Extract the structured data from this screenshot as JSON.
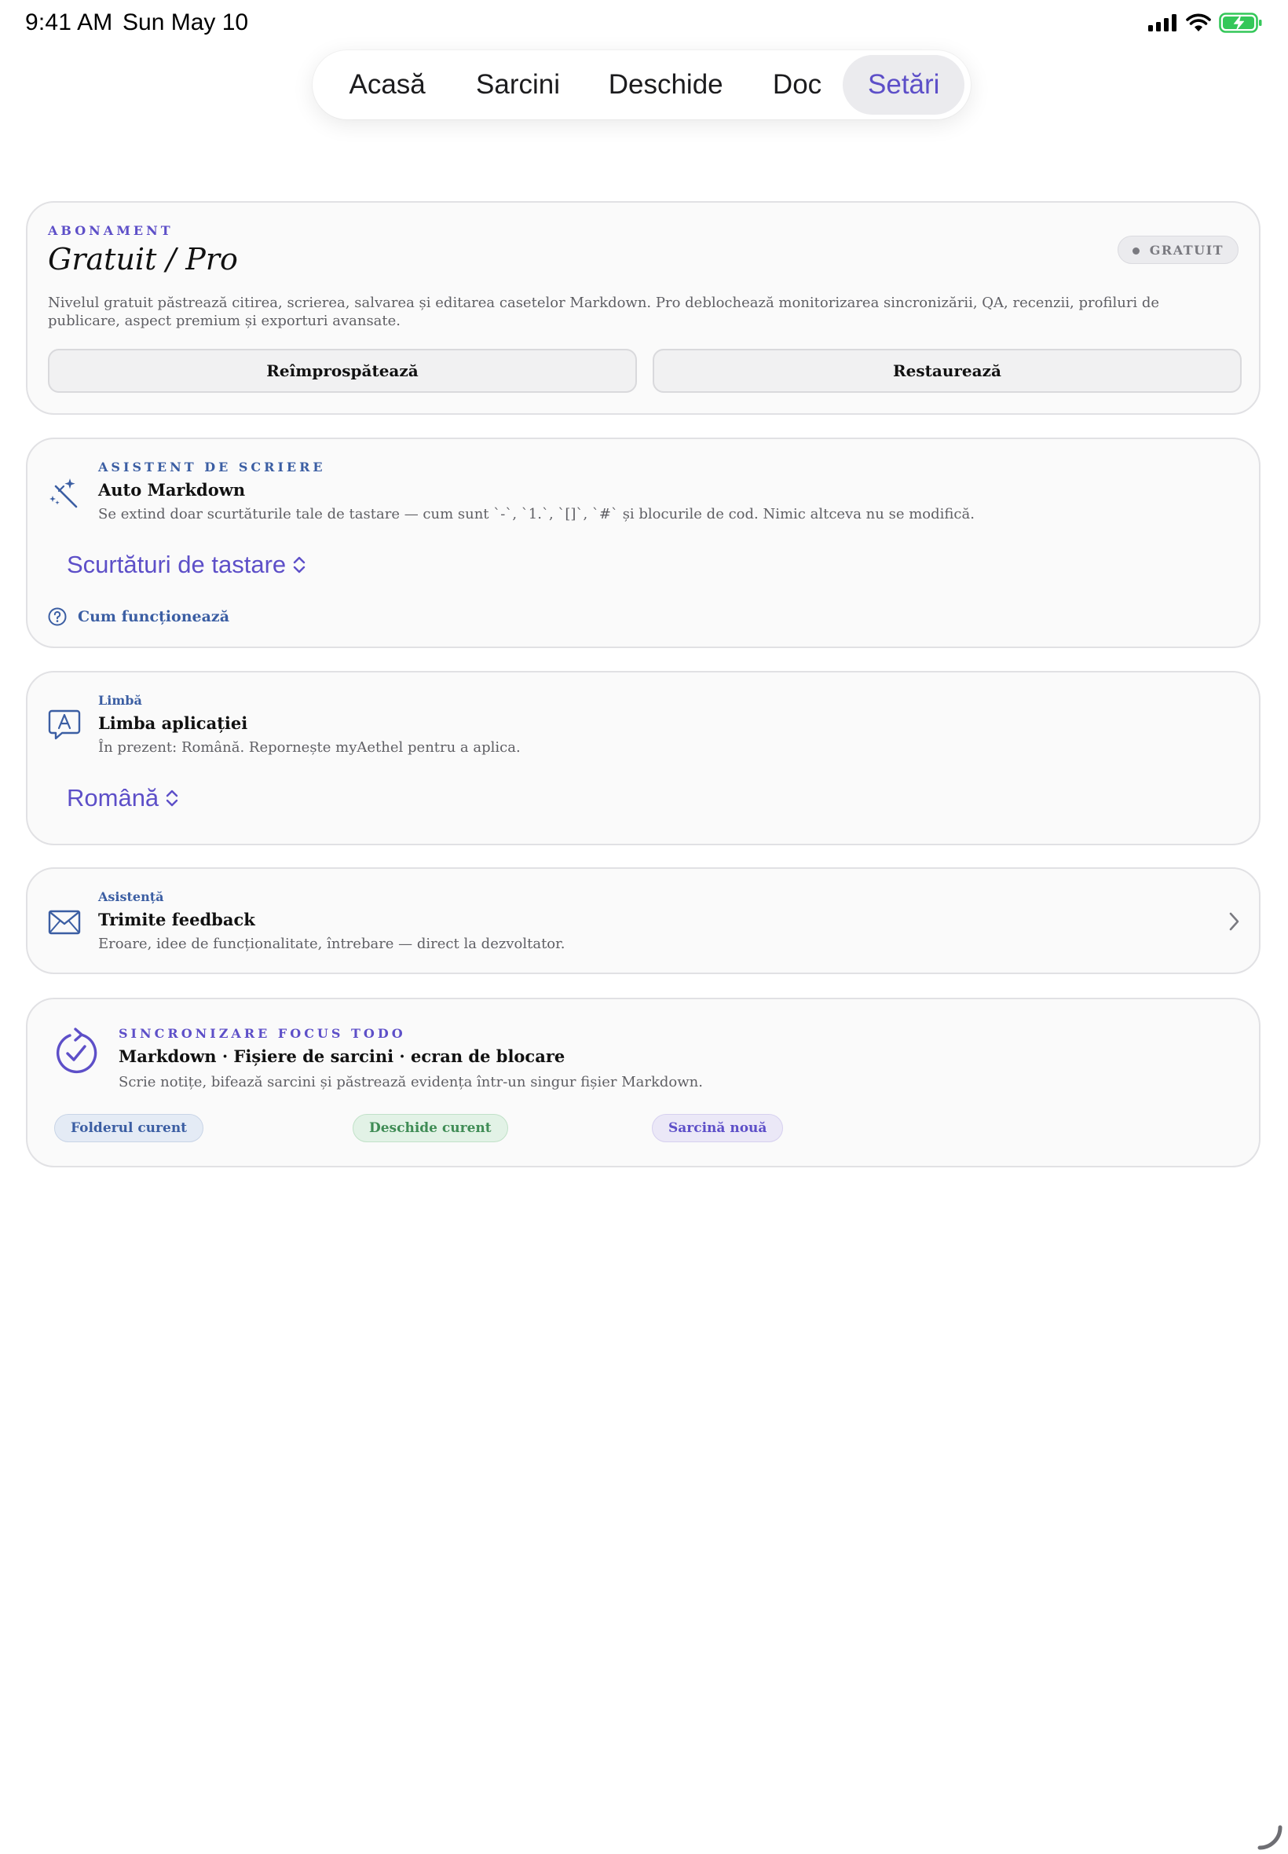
{
  "status_bar": {
    "time": "9:41 AM",
    "date": "Sun May 10"
  },
  "tabs": [
    {
      "label": "Acasă",
      "active": false
    },
    {
      "label": "Sarcini",
      "active": false
    },
    {
      "label": "Deschide",
      "active": false
    },
    {
      "label": "Doc",
      "active": false
    },
    {
      "label": "Setări",
      "active": true
    }
  ],
  "subscription": {
    "eyebrow": "ABONAMENT",
    "title": "Gratuit / Pro",
    "badge": "GRATUIT",
    "description": "Nivelul gratuit păstrează citirea, scrierea, salvarea și editarea casetelor Markdown. Pro deblochează monitorizarea sincronizării, QA, recenzii, profiluri de publicare, aspect premium și exporturi avansate.",
    "refresh_label": "Reîmprospătează",
    "restore_label": "Restaurează"
  },
  "writing_assistant": {
    "icon": "magic-wand-icon",
    "eyebrow": "ASISTENT DE SCRIERE",
    "title": "Auto Markdown",
    "description": "Se extind doar scurtăturile tale de tastare — cum sunt `-`, `1.`, `[]`, `#` și blocurile de cod. Nimic altceva nu se modifică.",
    "picker_value": "Scurtături de tastare",
    "help_label": "Cum funcționează"
  },
  "language": {
    "icon": "language-bubble-icon",
    "eyebrow": "Limbă",
    "title": "Limba aplicației",
    "description": "În prezent: Română. Repornește myAethel pentru a aplica.",
    "picker_value": "Română"
  },
  "support": {
    "icon": "envelope-icon",
    "eyebrow": "Asistență",
    "title": "Trimite feedback",
    "description": "Eroare, idee de funcționalitate, întrebare — direct la dezvoltator."
  },
  "focus_sync": {
    "icon": "sync-check-icon",
    "eyebrow": "SINCRONIZARE FOCUS TODO",
    "title": "Markdown · Fișiere de sarcini · ecran de blocare",
    "description": "Scrie notițe, bifează sarcini și păstrează evidența într-un singur fișier Markdown.",
    "chips": [
      "Folderul curent",
      "Deschide curent",
      "Sarcină nouă"
    ]
  },
  "colors": {
    "accent": "#5d4fc8",
    "secondary": "#3b5ea3",
    "card_bg": "#fafafa",
    "battery": "#34c759"
  }
}
